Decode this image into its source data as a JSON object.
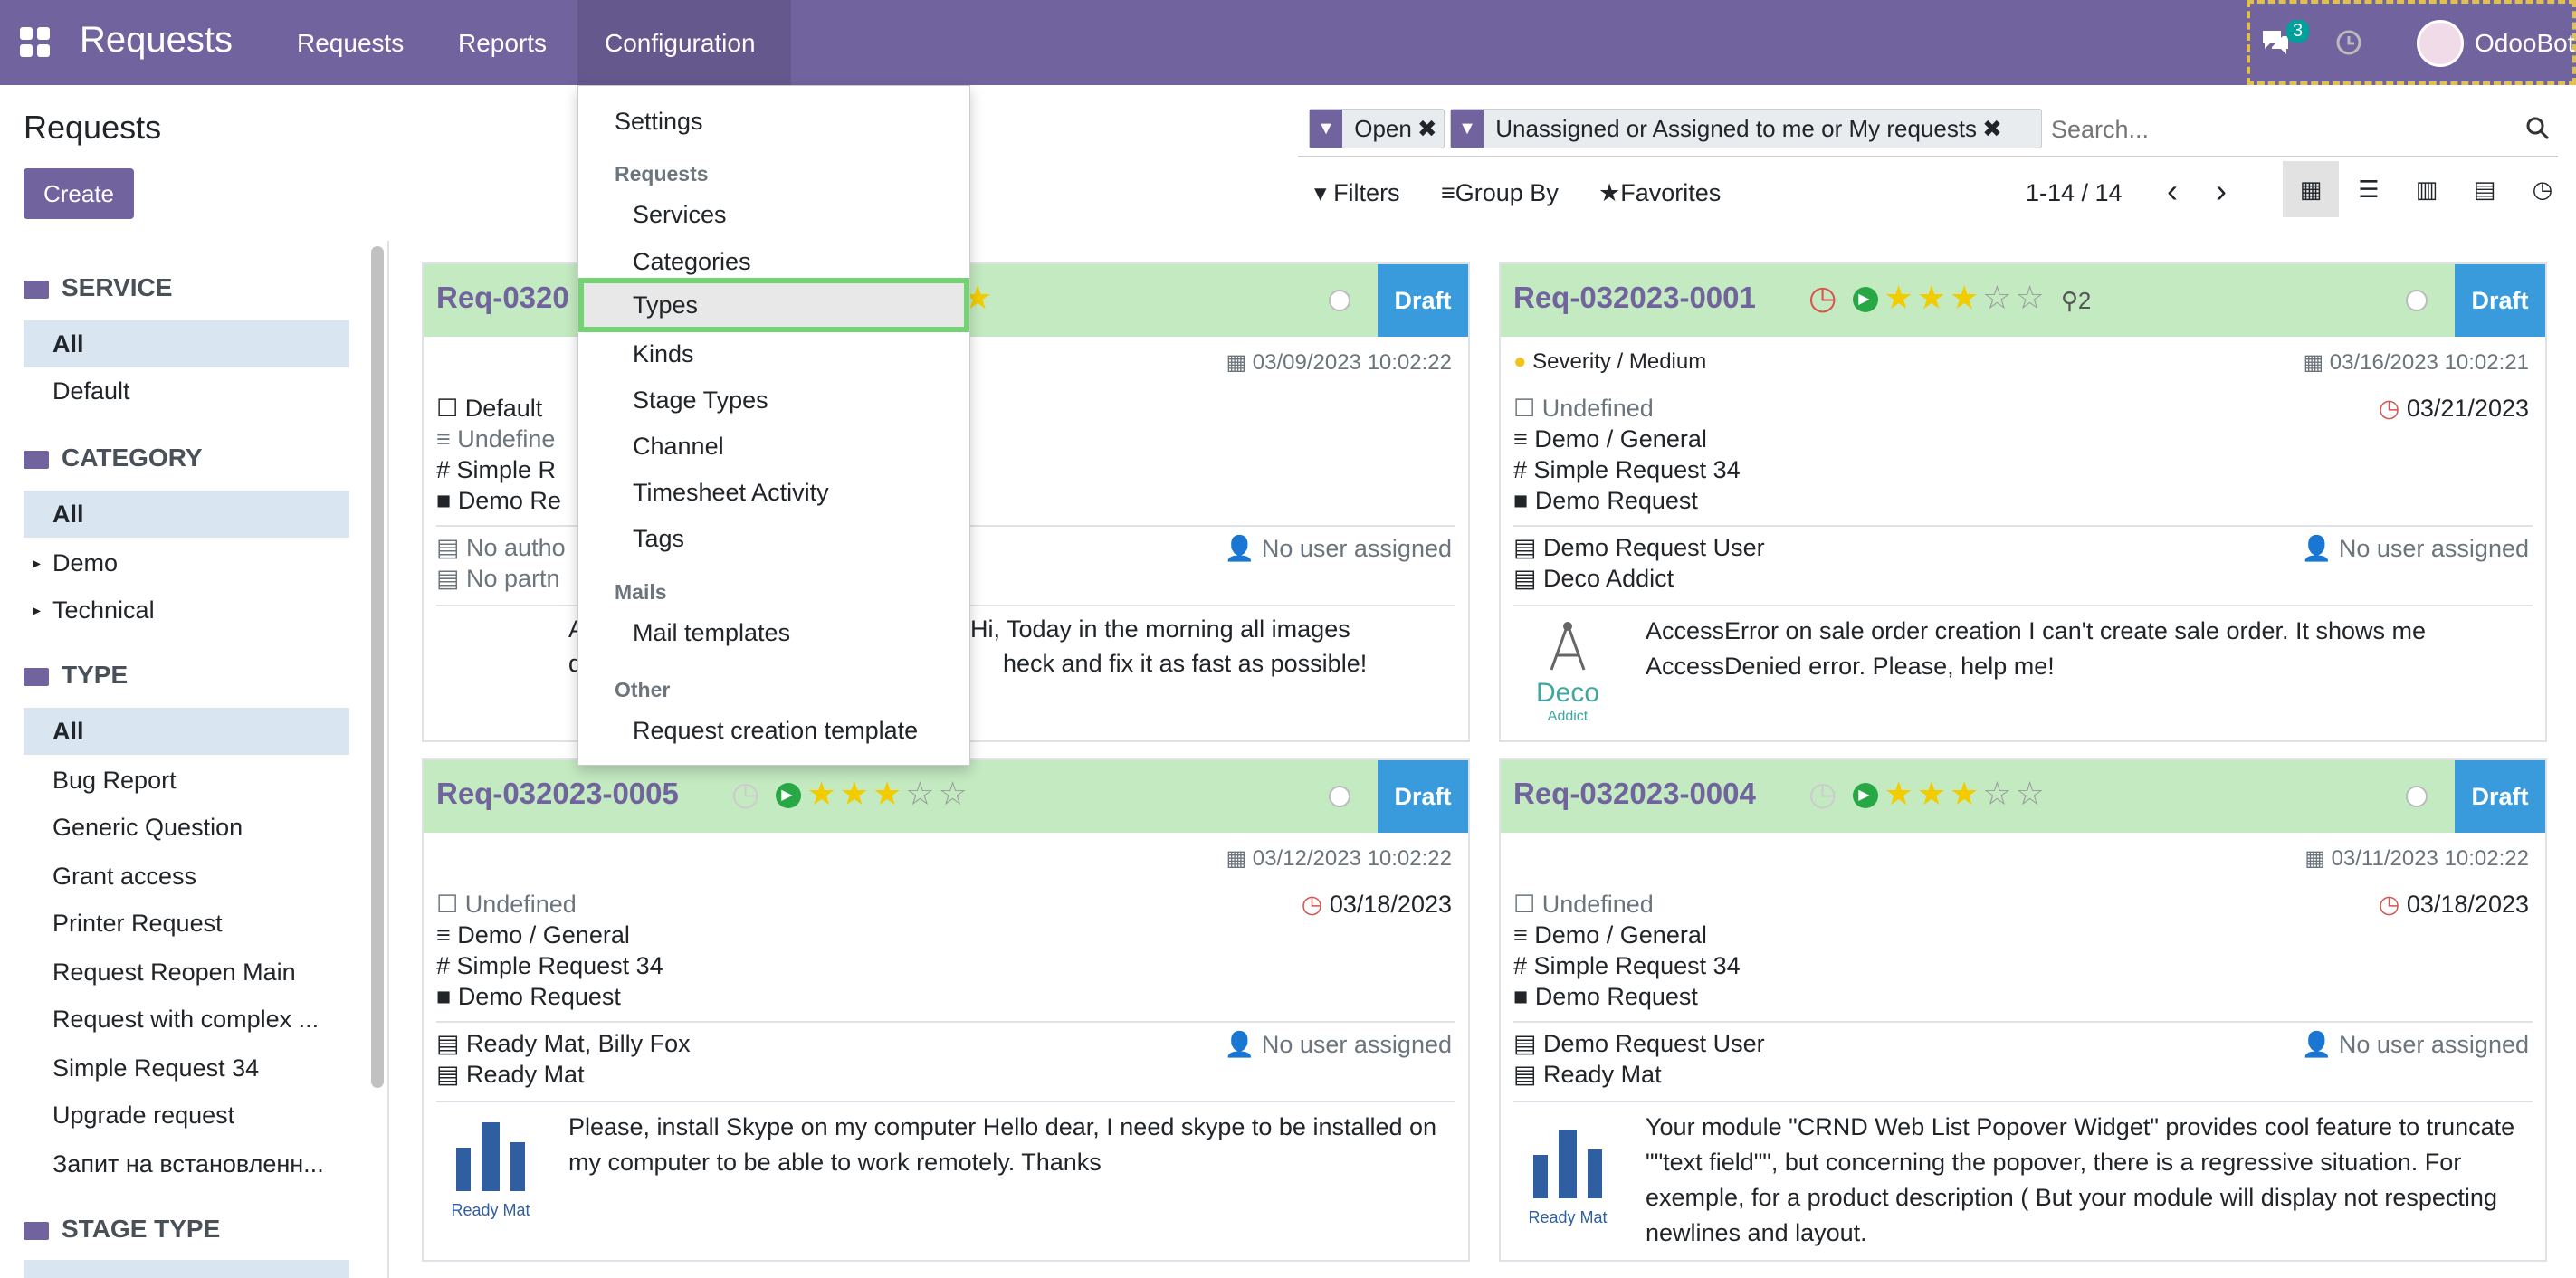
{
  "topbar": {
    "app_title": "Requests",
    "menu": [
      "Requests",
      "Reports",
      "Configuration"
    ],
    "chat_count": "3",
    "user_name": "OdooBot"
  },
  "control_panel": {
    "title": "Requests",
    "create_label": "Create",
    "facets": [
      "Open",
      "Unassigned or Assigned to me or My requests"
    ],
    "search_placeholder": "Search...",
    "filters_label": "Filters",
    "groupby_label": "Group By",
    "favorites_label": "Favorites",
    "pager": "1-14 / 14"
  },
  "sidebar": {
    "service_head": "SERVICE",
    "service_items": [
      "All",
      "Default"
    ],
    "category_head": "CATEGORY",
    "category_items": [
      "All",
      "Demo",
      "Technical"
    ],
    "type_head": "TYPE",
    "type_items": [
      "All",
      "Bug Report",
      "Generic Question",
      "Grant access",
      "Printer Request",
      "Request Reopen Main",
      "Request with complex ...",
      "Simple Request 34",
      "Upgrade request",
      "Запит на встановленн..."
    ],
    "stage_type_head": "STAGE TYPE"
  },
  "dropdown": {
    "settings": "Settings",
    "requests_head": "Requests",
    "requests_items": [
      "Services",
      "Categories",
      "Types",
      "Kinds",
      "Stage Types",
      "Channel",
      "Timesheet Activity",
      "Tags"
    ],
    "mails_head": "Mails",
    "mails_items": [
      "Mail templates"
    ],
    "other_head": "Other",
    "other_items": [
      "Request creation template"
    ]
  },
  "cards": [
    {
      "title": "Req-0320",
      "stage": "Draft",
      "created": "03/09/2023 10:02:22",
      "service": "Default",
      "category": "Undefine",
      "type": "Simple R",
      "kind": "Demo Re",
      "author": "No autho",
      "partner": "No partn",
      "assignee": "No user assigned",
      "desc_1": "A",
      "desc_2": "Hi, Today in the morning all images",
      "desc_3": "d",
      "desc_4": "heck and fix it as fast as possible!"
    },
    {
      "title": "Req-032023-0001",
      "stage": "Draft",
      "followers": "2",
      "severity": "Severity / Medium",
      "created": "03/16/2023 10:02:21",
      "service": "Undefined",
      "deadline": "03/21/2023",
      "category": "Demo / General",
      "type": "Simple Request 34",
      "kind": "Demo Request",
      "author": "Demo Request User",
      "partner": "Deco Addict",
      "assignee": "No user assigned",
      "logo_name": "Deco",
      "logo_sub": "Addict",
      "description": "AccessError on sale order creation I can't create sale order. It shows me AccessDenied error. Please, help me!"
    },
    {
      "title": "Req-032023-0005",
      "stage": "Draft",
      "created": "03/12/2023 10:02:22",
      "service": "Undefined",
      "deadline": "03/18/2023",
      "category": "Demo / General",
      "type": "Simple Request 34",
      "kind": "Demo Request",
      "author": "Ready Mat, Billy Fox",
      "partner": "Ready Mat",
      "assignee": "No user assigned",
      "logo_name": "Ready Mat",
      "description": "Please, install Skype on my computer Hello dear, I need skype to be installed on my computer to be able to work remotely. Thanks"
    },
    {
      "title": "Req-032023-0004",
      "stage": "Draft",
      "created": "03/11/2023 10:02:22",
      "service": "Undefined",
      "deadline": "03/18/2023",
      "category": "Demo / General",
      "type": "Simple Request 34",
      "kind": "Demo Request",
      "author": "Demo Request User",
      "partner": "Ready Mat",
      "assignee": "No user assigned",
      "logo_name": "Ready Mat",
      "description": "Your module \"CRND Web List Popover Widget\" provides cool feature to truncate \"\"text field\"\", but concerning the popover, there is a regressive situation. For exemple, for a product description ( But your module will display not respecting newlines and layout."
    }
  ],
  "colors": {
    "brand": "#71639e",
    "draft": "#3a9bdc",
    "card_head": "#c4eac1",
    "highlight": "#72d572"
  }
}
